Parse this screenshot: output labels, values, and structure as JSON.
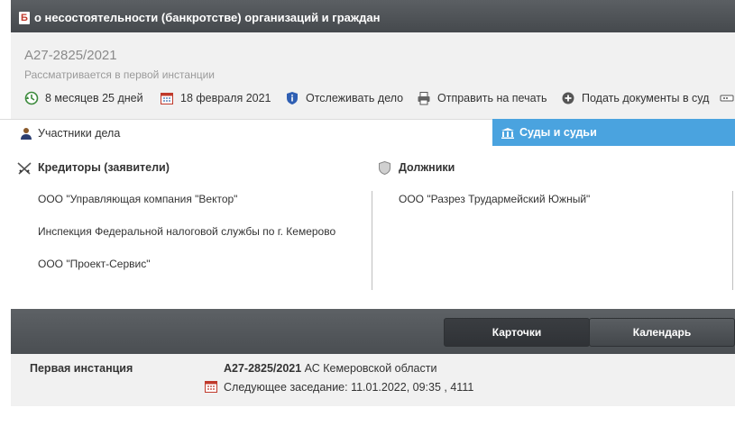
{
  "header": {
    "badge": "Б",
    "title": "о несостоятельности (банкротстве) организаций и граждан"
  },
  "case": {
    "number": "А27-2825/2021",
    "status": "Рассматривается в первой инстанции",
    "actions": [
      {
        "label": "8 месяцев 25 дней",
        "icon": "clock-arrow-icon"
      },
      {
        "label": "18 февраля 2021",
        "icon": "calendar-icon"
      },
      {
        "label": "Отслеживать дело",
        "icon": "shield-info-icon"
      },
      {
        "label": "Отправить на печать",
        "icon": "printer-icon"
      },
      {
        "label": "Подать документы в суд",
        "icon": "plus-circle-icon"
      }
    ]
  },
  "tabs": {
    "participants": "Участники дела",
    "courts": "Суды и судьи"
  },
  "parties": {
    "creditors_title": "Кредиторы (заявители)",
    "creditors": [
      "ООО \"Управляющая компания \"Вектор\"",
      "Инспекция Федеральной налоговой службы по г. Кемерово",
      "ООО \"Проект-Сервис\""
    ],
    "debtors_title": "Должники",
    "debtors": [
      "ООО \"Разрез Трудармейский Южный\""
    ]
  },
  "view_buttons": {
    "cards": "Карточки",
    "calendar": "Календарь"
  },
  "instance": {
    "label": "Первая инстанция",
    "case_number": "А27-2825/2021",
    "court": "АС Кемеровской области",
    "next_session": "Следующее заседание: 11.01.2022, 09:35 , 4111"
  },
  "colors": {
    "header_bg": "#4f5357",
    "tab_active": "#4aa3df",
    "panel_bg": "#f1f1f1"
  }
}
